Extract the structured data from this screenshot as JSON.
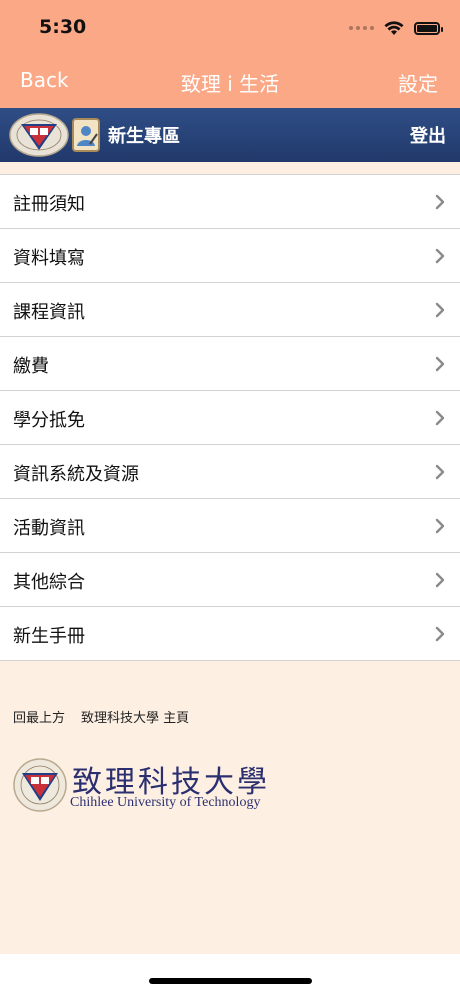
{
  "status": {
    "time": "5:30"
  },
  "nav": {
    "back": "Back",
    "title": "致理 i 生活",
    "settings": "設定"
  },
  "banner": {
    "title": "新生專區",
    "logout": "登出"
  },
  "menu": [
    {
      "label": "註冊須知"
    },
    {
      "label": "資料填寫"
    },
    {
      "label": "課程資訊"
    },
    {
      "label": "繳費"
    },
    {
      "label": "學分抵免"
    },
    {
      "label": "資訊系統及資源"
    },
    {
      "label": "活動資訊"
    },
    {
      "label": "其他綜合"
    },
    {
      "label": "新生手冊"
    }
  ],
  "footer": {
    "back_to_top": "回最上方",
    "homepage": "致理科技大學 主頁",
    "logo_zh": "致理科技大學",
    "logo_en": "Chihlee University of Technology"
  },
  "colors": {
    "nav": "#fba887",
    "banner": "#2a4478",
    "footer_bg": "#fdf0e3"
  }
}
